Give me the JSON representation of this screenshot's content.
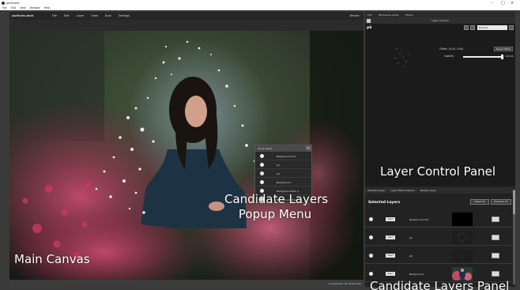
{
  "os": {
    "title": "particlefx",
    "menu": [
      "File",
      "Edit",
      "View",
      "Window",
      "Help"
    ],
    "controls": [
      "–",
      "□",
      "×"
    ]
  },
  "app": {
    "brand": "particles.dust",
    "menu": [
      "File",
      "Edit",
      "Layer",
      "View",
      "Dust",
      "Settings"
    ],
    "render_label": "Render"
  },
  "canvas": {
    "label": "Main Canvas",
    "status_text": "Current tool: No Active Tool"
  },
  "popup": {
    "header": "Quick Select",
    "close": "×",
    "items": [
      "Background Tint",
      "p2",
      "p6",
      "Background",
      "Background Blur 2",
      "Background Blur 3"
    ],
    "annotation_line1": "Candidate Layers",
    "annotation_line2": "Popup Menu"
  },
  "right_panel": {
    "tabs": [
      "Edit",
      "Workspace panel",
      "Others"
    ],
    "subheader": "Layer Controls",
    "layer_name": "p6",
    "blend_mode": "Normal",
    "offset": "Offset: (0.00, 0.00)",
    "reset_label": "Reset Offset",
    "opacity_label": "Opacity",
    "opacity_value": "100.00",
    "opacity_fraction": 1.0,
    "annotation": "Layer Control Panel"
  },
  "candidates": {
    "tabs": [
      "Selected Layer",
      "Layer Effect Options",
      "Render Layer"
    ],
    "heading": "Selected Layers",
    "select_all": "Select All",
    "deselect_all": "Deselect All",
    "select_label": "Select",
    "rows": [
      {
        "name": "Background Tint",
        "thumb": "black"
      },
      {
        "name": "p2",
        "thumb": "dust"
      },
      {
        "name": "p6",
        "thumb": "dust-small"
      },
      {
        "name": "Background",
        "thumb": "photo"
      }
    ],
    "annotation": "Candidate Layers Panel"
  }
}
